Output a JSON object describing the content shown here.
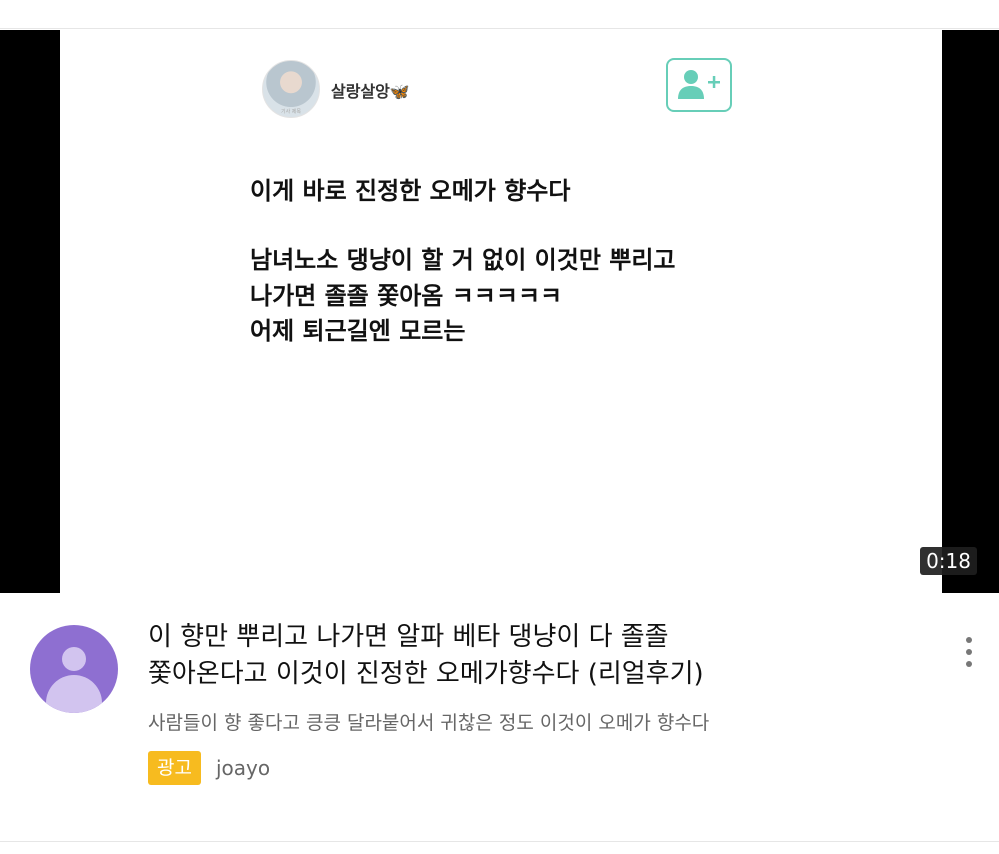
{
  "video": {
    "profile": {
      "name": "살랑살앙🦋",
      "caption": "기사 제목"
    },
    "post_lines": [
      "이게 바로 진정한 오메가 향수다",
      "남녀노소 댕냥이 할 거 없이 이것만 뿌리고",
      "나가면 졸졸 쫓아옴 ㅋㅋㅋㅋㅋ",
      "어제 퇴근길엔 모르는"
    ],
    "duration": "0:18"
  },
  "meta": {
    "title_lines": [
      "이 향만 뿌리고 나가면 알파 베타 댕냥이 다 졸졸",
      "쫓아온다고 이것이 진정한 오메가향수다 (리얼후기)"
    ],
    "subtitle": "사람들이 향 좋다고 킁킁 달라붙어서 귀찮은 정도 이것이 오메가 향수다",
    "ad_label": "광고",
    "advertiser": "joayo"
  },
  "icons": {
    "follow": "add-user-icon",
    "more": "more-vert-icon",
    "avatar": "person-icon"
  },
  "colors": {
    "follow_accent": "#67ceb8",
    "ad_badge": "#f7bb1f",
    "channel_avatar": "#8e6fd1"
  }
}
